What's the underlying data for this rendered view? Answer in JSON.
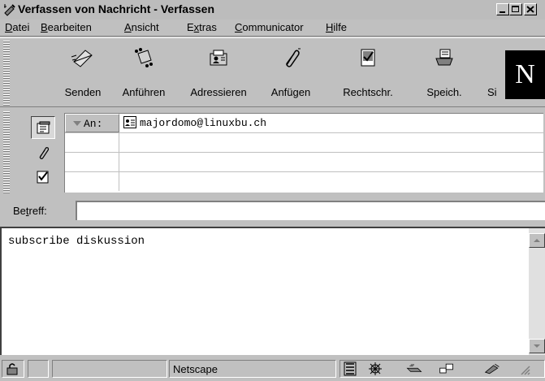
{
  "window": {
    "title": "Verfassen von Nachricht - Verfassen"
  },
  "menu": [
    {
      "pre": "",
      "accel": "D",
      "post": "atei"
    },
    {
      "pre": "",
      "accel": "B",
      "post": "earbeiten"
    },
    {
      "pre": "",
      "accel": "A",
      "post": "nsicht"
    },
    {
      "pre": "E",
      "accel": "x",
      "post": "tras"
    },
    {
      "pre": "",
      "accel": "C",
      "post": "ommunicator"
    },
    {
      "pre": "",
      "accel": "H",
      "post": "ilfe"
    }
  ],
  "toolbar": {
    "send_label": "Senden",
    "quote_label": "Anführen",
    "address_label": "Adressieren",
    "attach_label": "Anfügen",
    "spell_label": "Rechtschr.",
    "save_label": "Speich.",
    "security_label_partial": "Si"
  },
  "brand": {
    "logo_letter": "N"
  },
  "address": {
    "type_label": "An:",
    "recipient": "majordomo@linuxbu.ch"
  },
  "subject": {
    "label_pre": "Be",
    "label_accel": "t",
    "label_post": "reff:",
    "value": ""
  },
  "body": {
    "text": "subscribe diskussion"
  },
  "status": {
    "text": "Netscape"
  },
  "icons": {
    "title": "compose-icon",
    "send": "send-icon",
    "quote": "quote-icon",
    "address": "address-book-icon",
    "attach": "paperclip-icon",
    "spell": "spellcheck-icon",
    "save": "save-icon"
  }
}
